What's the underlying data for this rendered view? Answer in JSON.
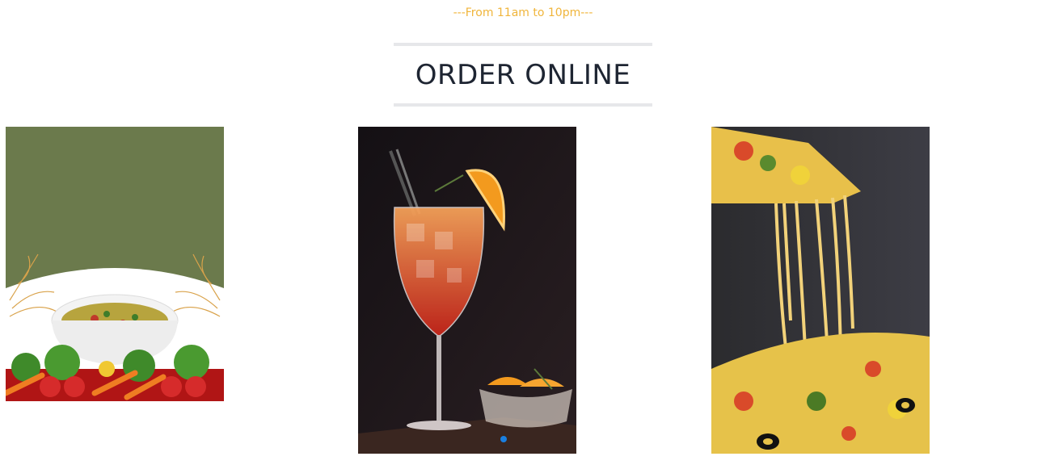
{
  "section": {
    "hours": "---From 11am to 10pm---",
    "title": "ORDER ONLINE"
  },
  "colors": {
    "hours_accent": "#f0b53b",
    "title_text": "#1e2532",
    "divider": "#e6e7ea",
    "carousel_dot_active": "#1a7fe0"
  },
  "cards": [
    {
      "name": "soup",
      "image": "vegetable-soup-photo"
    },
    {
      "name": "drink",
      "image": "orange-cocktail-photo"
    },
    {
      "name": "pizza",
      "image": "cheesy-pizza-photo"
    }
  ],
  "carousel": {
    "active_index": 0
  }
}
